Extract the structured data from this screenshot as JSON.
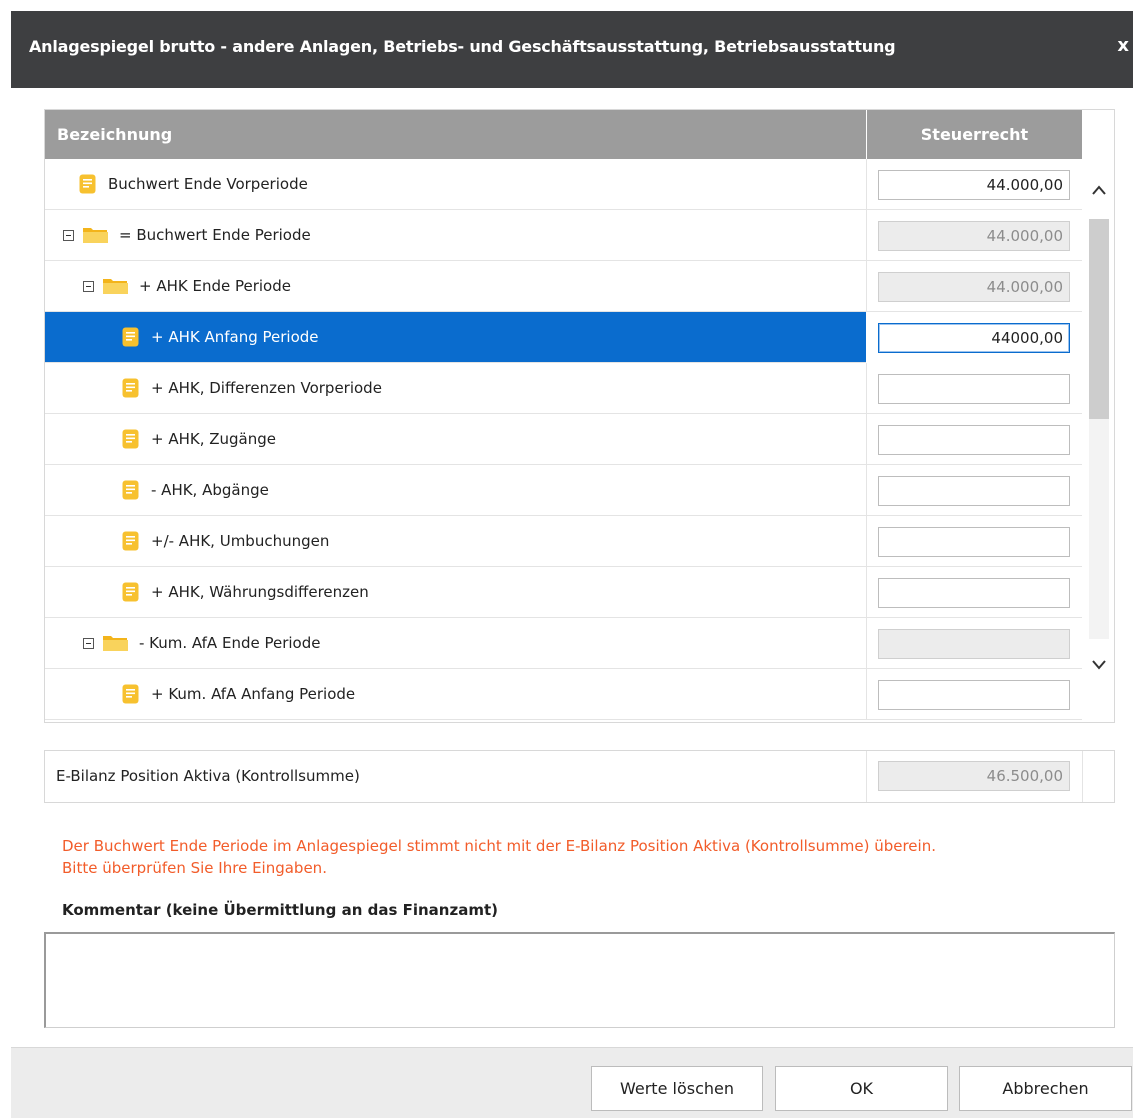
{
  "dialog": {
    "title": "Anlagespiegel brutto - andere Anlagen, Betriebs- und Geschäftsausstattung, Betriebsausstattung",
    "close_glyph": "x"
  },
  "grid": {
    "columns": {
      "name": "Bezeichnung",
      "value": "Steuerrecht"
    },
    "rows": [
      {
        "label": "Buchwert Ende Vorperiode",
        "value": "44.000,00",
        "kind": "doc",
        "readonly": false
      },
      {
        "label": "= Buchwert Ende Periode",
        "value": "44.000,00",
        "kind": "folder",
        "readonly": true
      },
      {
        "label": "+ AHK Ende Periode",
        "value": "44.000,00",
        "kind": "folder",
        "readonly": true
      },
      {
        "label": "+ AHK Anfang Periode",
        "value": "44000,00",
        "kind": "doc",
        "readonly": false,
        "selected": true
      },
      {
        "label": "+ AHK, Differenzen Vorperiode",
        "value": "",
        "kind": "doc",
        "readonly": false
      },
      {
        "label": "+ AHK, Zugänge",
        "value": "",
        "kind": "doc",
        "readonly": false
      },
      {
        "label": "- AHK, Abgänge",
        "value": "",
        "kind": "doc",
        "readonly": false
      },
      {
        "label": "+/- AHK, Umbuchungen",
        "value": "",
        "kind": "doc",
        "readonly": false
      },
      {
        "label": "+ AHK, Währungsdifferenzen",
        "value": "",
        "kind": "doc",
        "readonly": false
      },
      {
        "label": "- Kum. AfA Ende Periode",
        "value": "",
        "kind": "folder",
        "readonly": true
      },
      {
        "label": "+ Kum. AfA Anfang Periode",
        "value": "",
        "kind": "doc",
        "readonly": false
      }
    ]
  },
  "summary": {
    "label": "E-Bilanz Position Aktiva (Kontrollsumme)",
    "value": "46.500,00"
  },
  "warning": {
    "line1": "Der Buchwert Ende Periode im Anlagespiegel stimmt nicht mit der E-Bilanz Position Aktiva (Kontrollsumme) überein.",
    "line2": "Bitte überprüfen Sie Ihre Eingaben."
  },
  "comment": {
    "label": "Kommentar (keine Übermittlung an das Finanzamt)",
    "value": ""
  },
  "buttons": {
    "clear": "Werte löschen",
    "ok": "OK",
    "cancel": "Abbrechen"
  },
  "colors": {
    "titlebar": "#3e3f41",
    "header": "#9c9c9c",
    "selected_row": "#0a6cce",
    "warning_text": "#f25c2a",
    "icon_yellow": "#f7c12f"
  }
}
